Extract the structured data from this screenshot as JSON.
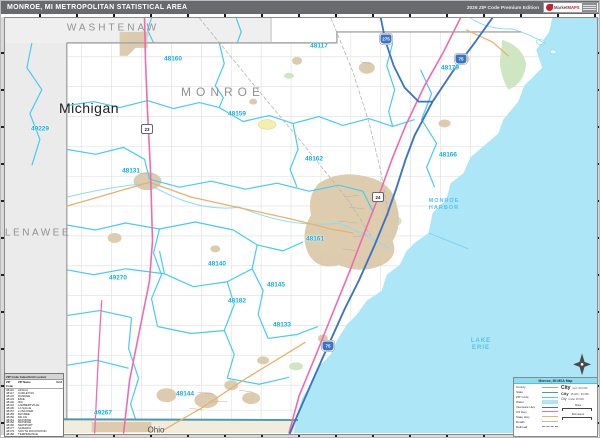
{
  "header": {
    "title": "MONROE, MI METROPOLITAN STATISTICAL AREA",
    "edition": "2026 ZIP Code Premium Edition",
    "logo": {
      "brand_primary": "Market",
      "brand_secondary": "MAPS"
    }
  },
  "map": {
    "state_labels": {
      "michigan": "Michigan",
      "ohio": "Ohio"
    },
    "county_labels": {
      "washtenaw": "WASHTENAW",
      "monroe": "MONROE",
      "lenawee": "LENAWEE"
    },
    "water_labels": {
      "lake_erie": "LAKE\nERIE",
      "monroe_harbor": "MONROE\nHARBOR"
    },
    "zip_labels": [
      {
        "code": "49229"
      },
      {
        "code": "48160"
      },
      {
        "code": "48117"
      },
      {
        "code": "48179"
      },
      {
        "code": "48159"
      },
      {
        "code": "48131"
      },
      {
        "code": "48162"
      },
      {
        "code": "48166"
      },
      {
        "code": "48161"
      },
      {
        "code": "49270"
      },
      {
        "code": "48140"
      },
      {
        "code": "48145"
      },
      {
        "code": "48182"
      },
      {
        "code": "48133"
      },
      {
        "code": "49267"
      },
      {
        "code": "48144"
      }
    ],
    "shields": [
      {
        "route": "275"
      },
      {
        "route": "75"
      },
      {
        "route": "23"
      },
      {
        "route": "24"
      },
      {
        "route": "75"
      }
    ],
    "colors": {
      "lake": "#ade6f7",
      "zip_boundary": "#45ccf0",
      "zip_label": "#12aee6",
      "county_label": "#8f9194",
      "us_highway": "#f06aae",
      "interstate": "#3c74c4",
      "state_highway": "#e8b26a",
      "urban_area": "#dcc9ab",
      "park": "#cfe6c2",
      "outside_county": "#ececec",
      "state_line": "#4f9aa8",
      "header_bar": "#696a6d"
    }
  },
  "zip_index": {
    "title": "ZIP Code Index/Grid Locator",
    "columns": {
      "code": "ZIP Code",
      "name": "ZIP Name",
      "grid": "Grid"
    },
    "rows": [
      {
        "code": "48110",
        "name": "AZALIA",
        "grid": ""
      },
      {
        "code": "48117",
        "name": "CARLETON",
        "grid": ""
      },
      {
        "code": "48131",
        "name": "DUNDEE",
        "grid": ""
      },
      {
        "code": "48133",
        "name": "ERIE",
        "grid": ""
      },
      {
        "code": "48140",
        "name": "IDA",
        "grid": ""
      },
      {
        "code": "48144",
        "name": "LAMBERTVILLE",
        "grid": ""
      },
      {
        "code": "48145",
        "name": "LA SALLE",
        "grid": ""
      },
      {
        "code": "48157",
        "name": "LUNA PIER",
        "grid": ""
      },
      {
        "code": "48159",
        "name": "MAYBEE",
        "grid": ""
      },
      {
        "code": "48160",
        "name": "MILAN",
        "grid": ""
      },
      {
        "code": "48161",
        "name": "MONROE",
        "grid": ""
      },
      {
        "code": "48162",
        "name": "MONROE",
        "grid": ""
      },
      {
        "code": "48166",
        "name": "NEWPORT",
        "grid": ""
      },
      {
        "code": "48177",
        "name": "SAMARIA",
        "grid": ""
      },
      {
        "code": "48179",
        "name": "SOUTH ROCKWOOD",
        "grid": ""
      },
      {
        "code": "48182",
        "name": "TEMPERANCE",
        "grid": ""
      },
      {
        "code": "49267",
        "name": "OTTAWA LAKE",
        "grid": ""
      },
      {
        "code": "49270",
        "name": "PETERSBURG",
        "grid": ""
      },
      {
        "code": "49276",
        "name": "RIGA",
        "grid": ""
      }
    ]
  },
  "legend": {
    "title": "Monroe, MI MSA Map",
    "items": [
      {
        "label": "County"
      },
      {
        "label": "State"
      },
      {
        "label": "ZIP Code"
      },
      {
        "label": "Water"
      },
      {
        "label": "Interstate Hwy"
      },
      {
        "label": "US Hwy"
      },
      {
        "label": "State Hwy"
      },
      {
        "label": "Roads"
      },
      {
        "label": "Railroad"
      }
    ],
    "cities": [
      {
        "sample": "City",
        "label": "over 100,000"
      },
      {
        "sample": "City",
        "label": "25,000 - 99,999"
      },
      {
        "sample": "City",
        "label": "under 25,000"
      }
    ],
    "scale": {
      "miles": "Miles",
      "kilometers": "Kilometers"
    }
  }
}
